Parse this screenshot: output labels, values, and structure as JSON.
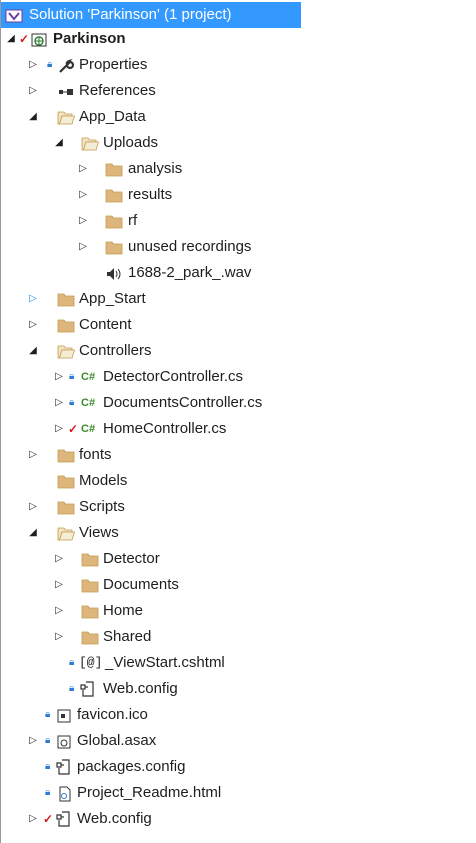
{
  "solution": {
    "label": "Solution 'Parkinson' (1 project)"
  },
  "project": {
    "label": "Parkinson"
  },
  "items": {
    "properties": "Properties",
    "references": "References",
    "app_data": "App_Data",
    "uploads": "Uploads",
    "analysis": "analysis",
    "results": "results",
    "rf": "rf",
    "unused_recordings": "unused recordings",
    "wav": "1688-2_park_.wav",
    "app_start": "App_Start",
    "content": "Content",
    "controllers": "Controllers",
    "detector_controller": "DetectorController.cs",
    "documents_controller": "DocumentsController.cs",
    "home_controller": "HomeController.cs",
    "fonts": "fonts",
    "models": "Models",
    "scripts": "Scripts",
    "views": "Views",
    "detector": "Detector",
    "documents": "Documents",
    "home": "Home",
    "shared": "Shared",
    "viewstart": "_ViewStart.cshtml",
    "views_webconfig": "Web.config",
    "favicon": "favicon.ico",
    "global": "Global.asax",
    "packages": "packages.config",
    "readme": "Project_Readme.html",
    "webconfig": "Web.config"
  },
  "colors": {
    "selection": "#3399ff",
    "folder": "#dcb67a",
    "lock": "#2b7bd0",
    "check": "#d11a1a",
    "csharp": "#3a8a2a"
  }
}
